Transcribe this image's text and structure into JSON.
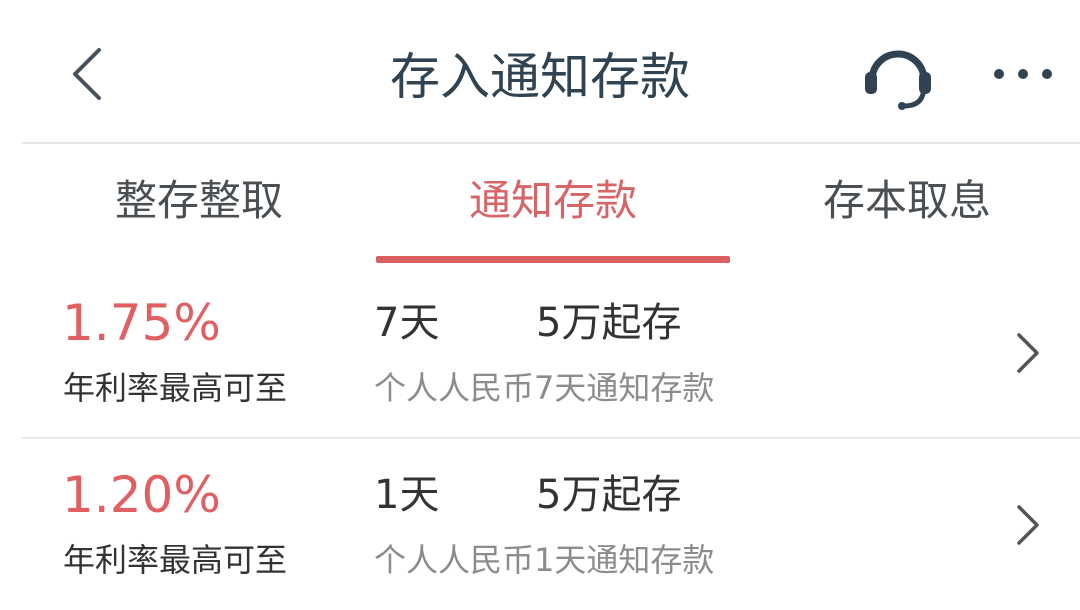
{
  "header": {
    "title": "存入通知存款",
    "back_icon": "chevron-left-icon",
    "service_icon": "headset-icon",
    "more_icon": "more-dots-icon"
  },
  "tabs": [
    {
      "label": "整存整取",
      "active": false
    },
    {
      "label": "通知存款",
      "active": true
    },
    {
      "label": "存本取息",
      "active": false
    }
  ],
  "products": [
    {
      "rate": "1.75%",
      "rate_desc": "年利率最高可至",
      "term": "7天",
      "min_deposit": "5万起存",
      "name": "个人人民币7天通知存款"
    },
    {
      "rate": "1.20%",
      "rate_desc": "年利率最高可至",
      "term": "1天",
      "min_deposit": "5万起存",
      "name": "个人人民币1天通知存款"
    }
  ],
  "colors": {
    "accent": "#d95f61",
    "title": "#2f4352",
    "text": "#333333",
    "muted": "#8c8c8c",
    "divider": "#e6e6e6"
  }
}
